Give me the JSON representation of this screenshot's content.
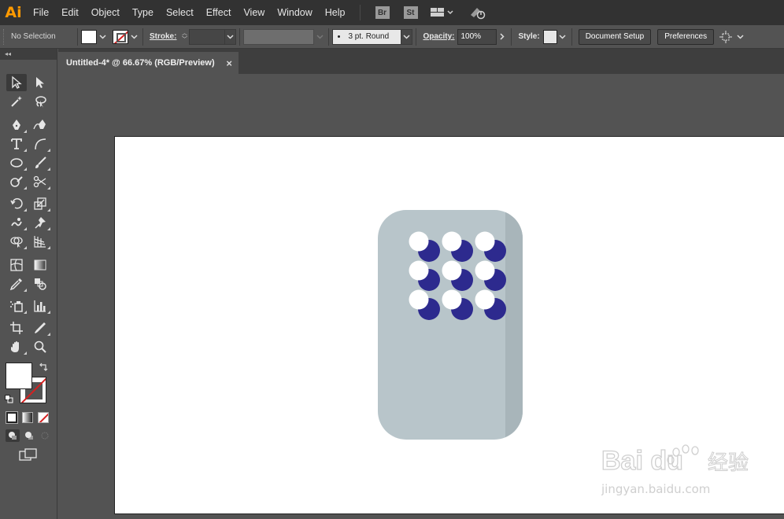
{
  "app": {
    "logo_text": "Ai",
    "colors": {
      "accent": "#ff9a00",
      "chrome_dark": "#323232",
      "chrome": "#535353",
      "artboard": "#ffffff"
    }
  },
  "menubar": {
    "items": [
      "File",
      "Edit",
      "Object",
      "Type",
      "Select",
      "Effect",
      "View",
      "Window",
      "Help"
    ],
    "bridge_label": "Br",
    "stock_label": "St"
  },
  "control_bar": {
    "selection_status": "No Selection",
    "stroke_label": "Stroke:",
    "brush_label": "3 pt. Round",
    "opacity_label": "Opacity:",
    "opacity_value": "100%",
    "style_label": "Style:",
    "document_setup_label": "Document Setup",
    "preferences_label": "Preferences",
    "fill_color": "#ffffff"
  },
  "tools_panel": {
    "collapse_glyph": "◂◂",
    "icons": [
      "selection-icon",
      "direct-selection-icon",
      "magic-wand-icon",
      "lasso-icon",
      "pen-icon",
      "curvature-icon",
      "type-icon",
      "arc-icon",
      "ellipse-icon",
      "paintbrush-icon",
      "shaper-icon",
      "scissors-icon",
      "rotate-icon",
      "scale-icon",
      "warp-icon",
      "puppet-warp-icon",
      "shape-builder-icon",
      "perspective-grid-icon",
      "mesh-icon",
      "gradient-icon",
      "eyedropper-icon",
      "blend-icon",
      "symbol-sprayer-icon",
      "column-graph-icon",
      "artboard-icon",
      "slice-icon",
      "hand-icon",
      "zoom-icon"
    ]
  },
  "document": {
    "tab_title": "Untitled-4* @ 66.67% (RGB/Preview)",
    "close_glyph": "×"
  },
  "artwork": {
    "body_color": "#b8c5ca",
    "shadow_color": "#a8b5ba",
    "dot_color": "#2d2a8e",
    "highlight_color": "#ffffff"
  },
  "watermark": {
    "brand": "Bai du",
    "cn": "经验",
    "url": "jingyan.baidu.com"
  }
}
